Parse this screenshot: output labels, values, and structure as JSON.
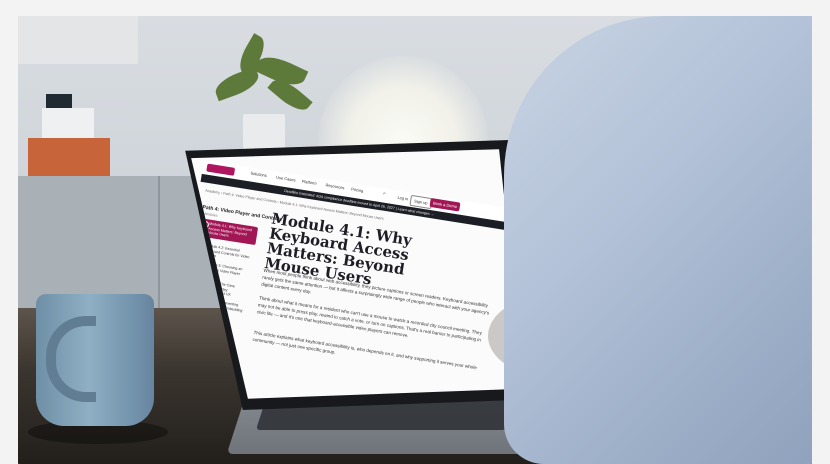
{
  "nav": {
    "items": [
      "Solutions",
      "Use Cases",
      "Platform",
      "Resources",
      "Pricing"
    ],
    "login": "Log in",
    "signup": "Sign up",
    "demo": "Book a Demo"
  },
  "banner": "Deadline Extended: ADA compliance deadline moved to April 26, 2027 | Learn what changes →",
  "breadcrumb": "Academy › Path 4: Video Player and Controls › Module 4.1: Why Keyboard Access Matters: Beyond Mouse Users",
  "sidebar": {
    "title": "Path 4: Video Player and Controls",
    "subtitle": "5 Modules",
    "items": [
      {
        "num": "1",
        "label": "Module 4.1: Why Keyboard Access Matters: Beyond Mouse Users",
        "active": true
      },
      {
        "num": "2",
        "label": "Module 4.2: Essential Keyboard Controls for Video Players",
        "active": false
      },
      {
        "num": "3",
        "label": "Module 4.3: Choosing an Accessible Video Player",
        "active": false
      },
      {
        "num": "4",
        "label": "Module 4.4: The Case Against Auto-Play: Accessibility and UX",
        "active": false
      },
      {
        "num": "5",
        "label": "Module 4.5: Implementing Accessible Video Embedding",
        "active": false
      }
    ]
  },
  "article": {
    "title": "Module 4.1: Why Keyboard Access Matters: Beyond Mouse Users",
    "paragraphs": [
      "When most people think about web accessibility, they picture captions or screen readers. Keyboard accessibility rarely gets the same attention — but it affects a surprisingly wide range of people who interact with your agency's digital content every day.",
      "Think about what it means for a resident who can't use a mouse to watch a recorded city council meeting. They may not be able to press play, rewind to catch a vote, or turn on captions. That's a real barrier to participating in civic life — and it's one that keyboard-accessible video players can remove.",
      "This article explains what keyboard accessibility is, who depends on it, and why supporting it serves your whole community — not just one specific group."
    ]
  },
  "colors": {
    "accent": "#a11655",
    "mug": "#7c9cb3",
    "shirt": "#b3c2d8"
  }
}
